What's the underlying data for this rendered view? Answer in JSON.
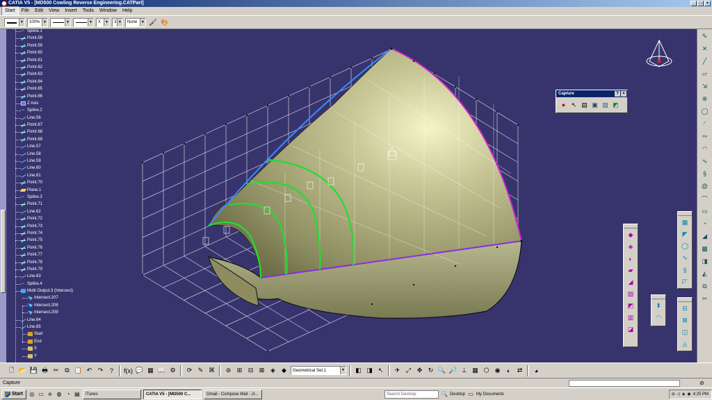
{
  "window": {
    "title": "CATIA V5 - [MD500 Cowling Reverse Engineering.CATPart]",
    "controls": [
      "_",
      "□",
      "×"
    ]
  },
  "menu": {
    "items": [
      "Start",
      "File",
      "Edit",
      "View",
      "Insert",
      "Tools",
      "Window",
      "Help"
    ]
  },
  "properties_toolbar": {
    "line_color": "",
    "transparency": "100%",
    "line_thickness": "",
    "line_type": "",
    "point_symbol": "X",
    "layer_num": "3",
    "layer": "None"
  },
  "tree": {
    "items": [
      {
        "label": "Spline.1",
        "icon": "spline-icon"
      },
      {
        "label": "Point.58",
        "icon": "point-icon"
      },
      {
        "label": "Point.59",
        "icon": "point-icon"
      },
      {
        "label": "Point.60",
        "icon": "point-icon"
      },
      {
        "label": "Point.61",
        "icon": "point-icon"
      },
      {
        "label": "Point.62",
        "icon": "point-icon"
      },
      {
        "label": "Point.63",
        "icon": "point-icon"
      },
      {
        "label": "Point.64",
        "icon": "point-icon"
      },
      {
        "label": "Point.65",
        "icon": "point-icon"
      },
      {
        "label": "Point.66",
        "icon": "point-icon"
      },
      {
        "label": "Z Axis",
        "icon": "axis-icon"
      },
      {
        "label": "Spline.2",
        "icon": "spline-icon"
      },
      {
        "label": "Line.56",
        "icon": "line-icon"
      },
      {
        "label": "Point.67",
        "icon": "point-icon"
      },
      {
        "label": "Point.68",
        "icon": "point-icon"
      },
      {
        "label": "Point.69",
        "icon": "point-icon"
      },
      {
        "label": "Line.57",
        "icon": "line-icon"
      },
      {
        "label": "Line.58",
        "icon": "line-icon"
      },
      {
        "label": "Line.59",
        "icon": "line-icon"
      },
      {
        "label": "Line.60",
        "icon": "line-icon"
      },
      {
        "label": "Line.61",
        "icon": "line-icon"
      },
      {
        "label": "Point.70",
        "icon": "point-icon"
      },
      {
        "label": "Plane.1",
        "icon": "plane-icon"
      },
      {
        "label": "Spline.3",
        "icon": "spline-icon"
      },
      {
        "label": "Point.71",
        "icon": "point-icon"
      },
      {
        "label": "Line.62",
        "icon": "line-icon"
      },
      {
        "label": "Point.72",
        "icon": "point-icon"
      },
      {
        "label": "Point.73",
        "icon": "point-icon"
      },
      {
        "label": "Point.74",
        "icon": "point-icon"
      },
      {
        "label": "Point.75",
        "icon": "point-icon"
      },
      {
        "label": "Point.76",
        "icon": "point-icon"
      },
      {
        "label": "Point.77",
        "icon": "point-icon"
      },
      {
        "label": "Point.78",
        "icon": "point-icon"
      },
      {
        "label": "Point.79",
        "icon": "point-icon"
      },
      {
        "label": "Line.63",
        "icon": "line-icon"
      },
      {
        "label": "Spline.4",
        "icon": "spline-icon"
      },
      {
        "label": "Multi Output.3 (Intersect)",
        "icon": "multi-output-icon"
      },
      {
        "label": "Intersect.207",
        "icon": "intersect-icon",
        "child": true
      },
      {
        "label": "Intersect.208",
        "icon": "intersect-icon",
        "child": true
      },
      {
        "label": "Intersect.209",
        "icon": "intersect-icon",
        "child": true
      },
      {
        "label": "Line.64",
        "icon": "line-icon"
      },
      {
        "label": "Line.65",
        "icon": "line-icon"
      },
      {
        "label": "Start",
        "icon": "sketch-icon",
        "child": true
      },
      {
        "label": "End",
        "icon": "sketch-icon",
        "child": true
      },
      {
        "label": "X",
        "icon": "axis-line-icon",
        "child": true
      },
      {
        "label": "Y",
        "icon": "axis-line-icon",
        "child": true
      }
    ]
  },
  "capture_toolbar": {
    "title": "Capture",
    "buttons": [
      "?",
      "×"
    ],
    "icons": [
      "record-icon",
      "select-icon",
      "options-icon",
      "capture-icon",
      "album-icon",
      "save-icon"
    ]
  },
  "bottom_toolbar": {
    "geometrical_set": "Geometrical Set.1"
  },
  "status": {
    "text": "Capture"
  },
  "taskbar": {
    "start_label": "Start",
    "buttons": [
      {
        "label": "iTunes",
        "active": false
      },
      {
        "label": "CATIA V5 - [MD500 C...",
        "active": true
      },
      {
        "label": "Gmail - Compose Mail - Jr...",
        "active": false
      }
    ],
    "search_placeholder": "Search Desktop",
    "desktop_label": "Desktop",
    "my_documents_label": "My Documents",
    "clock": "4:25 PM"
  },
  "colors": {
    "viewport_bg": "#37346d",
    "surface_fill": "#a4a47a",
    "green_curve": "#22dd33",
    "blue_curve": "#3a8cff",
    "magenta_curve": "#d020d0",
    "purple_curve": "#8a2be2"
  }
}
